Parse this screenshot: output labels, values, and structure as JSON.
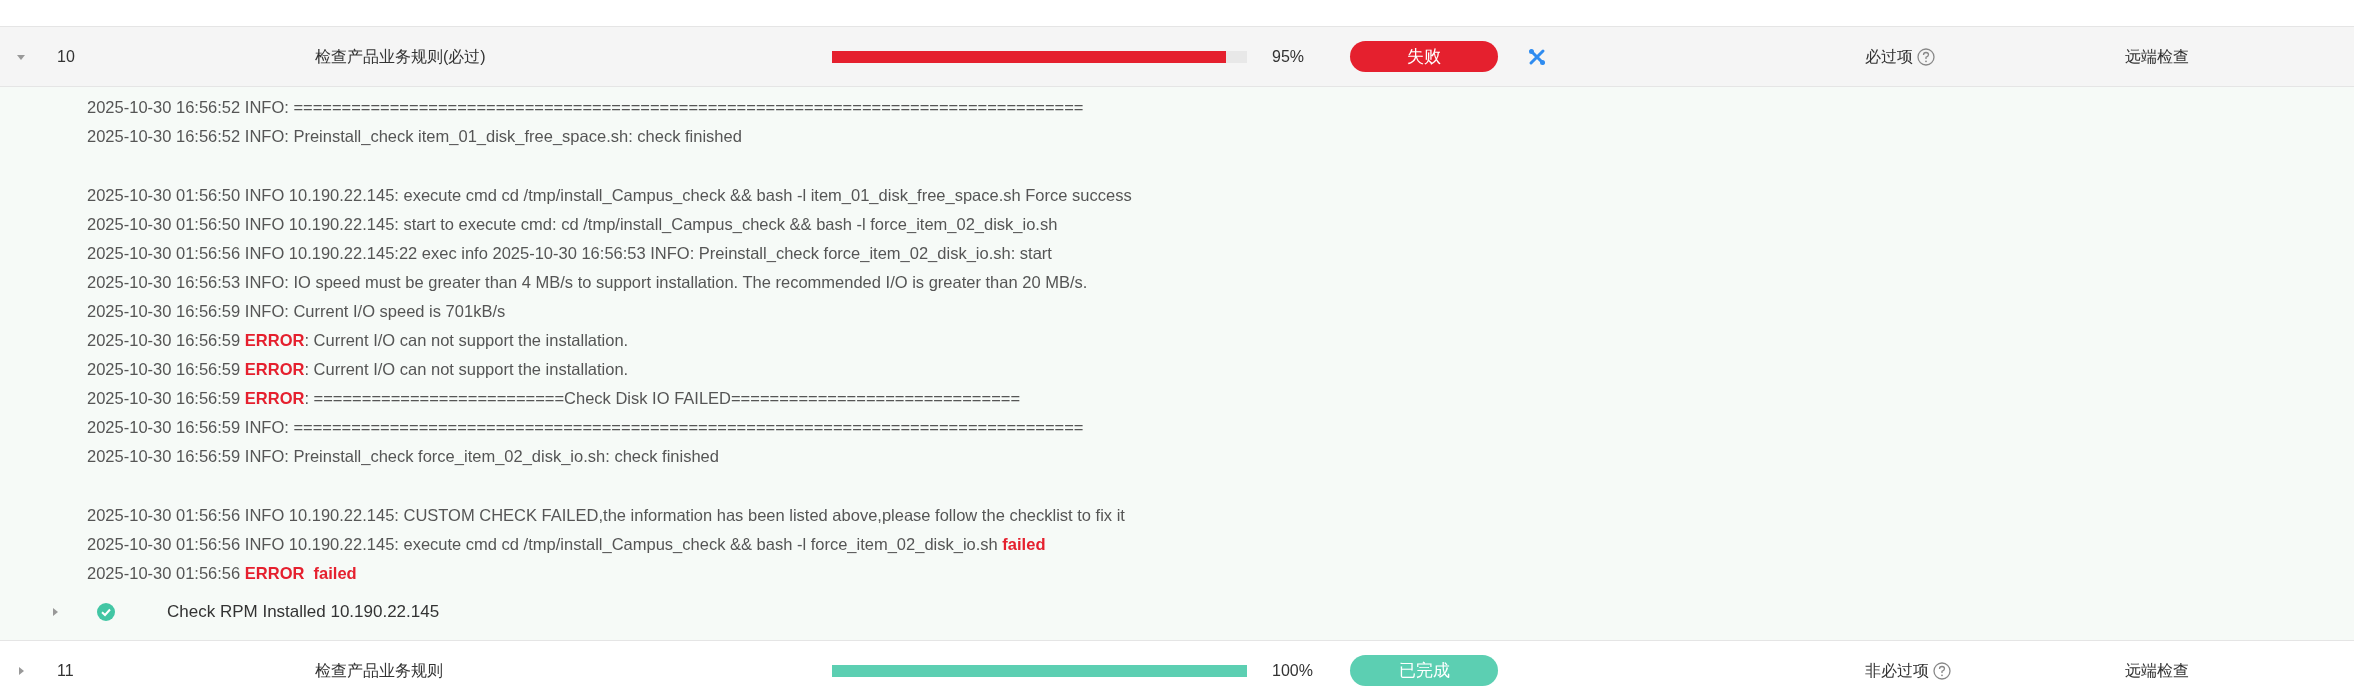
{
  "rows": [
    {
      "number": "10",
      "name": "检查产品业务规则(必过)",
      "level": 0.95,
      "percent": "95%",
      "status": {
        "label": "失败",
        "kind": "failed"
      },
      "fix_tool": true,
      "expanded": true,
      "requirement": "必过项",
      "method": "远端检查",
      "log_blocks": [
        [
          [
            {
              "text": "2025-10-30 16:56:52 INFO: ==================================================================================",
              "kind": "info"
            }
          ],
          [
            {
              "text": "2025-10-30 16:56:52 INFO: Preinstall_check item_01_disk_free_space.sh: check finished",
              "kind": "info"
            }
          ]
        ],
        [
          [
            {
              "text": "2025-10-30 01:56:50 INFO 10.190.22.145: execute cmd cd /tmp/install_Campus_check && bash -l item_01_disk_free_space.sh Force success",
              "kind": "info"
            }
          ],
          [
            {
              "text": "2025-10-30 01:56:50 INFO 10.190.22.145: start to execute cmd: cd /tmp/install_Campus_check && bash -l force_item_02_disk_io.sh",
              "kind": "info"
            }
          ],
          [
            {
              "text": "2025-10-30 01:56:56 INFO 10.190.22.145:22 exec info 2025-10-30 16:56:53 INFO: Preinstall_check force_item_02_disk_io.sh: start",
              "kind": "info"
            }
          ],
          [
            {
              "text": "2025-10-30 16:56:53 INFO: IO speed must be greater than 4 MB/s to support installation. The recommended I/O is greater than 20 MB/s.",
              "kind": "info"
            }
          ],
          [
            {
              "text": "2025-10-30 16:56:59 INFO: Current I/O speed is 701kB/s",
              "kind": "info"
            }
          ],
          [
            {
              "text": "2025-10-30 16:56:59 ",
              "kind": "info"
            },
            {
              "text": "ERROR",
              "kind": "error"
            },
            {
              "text": ": Current I/O can not support the installation.",
              "kind": "info"
            }
          ],
          [
            {
              "text": "2025-10-30 16:56:59 ",
              "kind": "info"
            },
            {
              "text": "ERROR",
              "kind": "error"
            },
            {
              "text": ": Current I/O can not support the installation.",
              "kind": "info"
            }
          ],
          [
            {
              "text": "2025-10-30 16:56:59 ",
              "kind": "info"
            },
            {
              "text": "ERROR",
              "kind": "error"
            },
            {
              "text": ": ==========================Check Disk IO FAILED==============================",
              "kind": "info"
            }
          ],
          [
            {
              "text": "2025-10-30 16:56:59 INFO: ==================================================================================",
              "kind": "info"
            }
          ],
          [
            {
              "text": "2025-10-30 16:56:59 INFO: Preinstall_check force_item_02_disk_io.sh: check finished",
              "kind": "info"
            }
          ]
        ],
        [
          [
            {
              "text": "2025-10-30 01:56:56 INFO 10.190.22.145: CUSTOM CHECK FAILED,the information has been listed above,please follow the checklist to fix it",
              "kind": "info"
            }
          ],
          [
            {
              "text": "2025-10-30 01:56:56 INFO 10.190.22.145: execute cmd cd /tmp/install_Campus_check && bash -l force_item_02_disk_io.sh ",
              "kind": "info"
            },
            {
              "text": "failed",
              "kind": "error"
            }
          ],
          [
            {
              "text": "2025-10-30 01:56:56 ",
              "kind": "info"
            },
            {
              "text": "ERROR",
              "kind": "error"
            },
            {
              "text": "  failed",
              "kind": "error"
            }
          ]
        ]
      ],
      "sub_items": [
        {
          "label": "Check RPM Installed 10.190.22.145",
          "expanded": false,
          "passed": true
        }
      ]
    },
    {
      "number": "11",
      "name": "检查产品业务规则",
      "level": 1.0,
      "percent": "100%",
      "status": {
        "label": "已完成",
        "kind": "completed"
      },
      "fix_tool": false,
      "expanded": false,
      "requirement": "非必过项",
      "method": "远端检查"
    }
  ]
}
